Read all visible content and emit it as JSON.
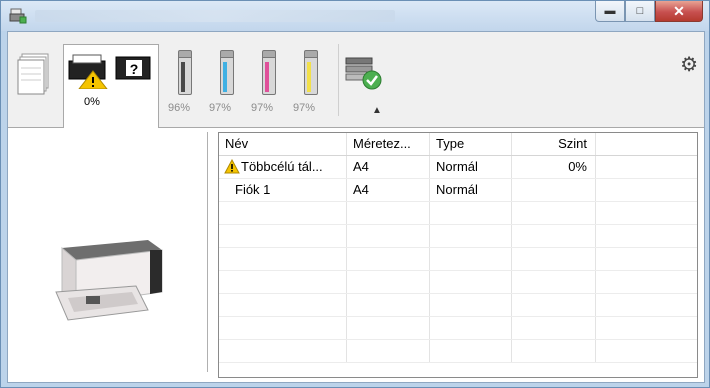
{
  "window": {
    "title_icon": "printer-app-icon",
    "buttons": {
      "minimize": "minimize-icon",
      "maximize": "maximize-icon",
      "close": "close-icon"
    }
  },
  "toolbar": {
    "status_tab": {
      "percent": "0%",
      "icons": [
        "paper-stack-icon",
        "printer-warning-icon",
        "printer-unknown-icon"
      ]
    },
    "toners": [
      {
        "percent": "96%",
        "color": "#4a4a4a"
      },
      {
        "percent": "97%",
        "color": "#3fb0e3"
      },
      {
        "percent": "97%",
        "color": "#e0509a"
      },
      {
        "percent": "97%",
        "color": "#f2e04a"
      }
    ],
    "tray_icon": "paper-tray-check-icon",
    "collapse_icon": "chevron-up-icon",
    "settings_icon": "gear-icon"
  },
  "table": {
    "columns": [
      "Név",
      "Méretez...",
      "Type",
      "Szint"
    ],
    "rows": [
      {
        "name": "Többcélú tál...",
        "size": "A4",
        "type": "Normál",
        "level": "0%",
        "warning": true
      },
      {
        "name": "Fiók 1",
        "size": "A4",
        "type": "Normál",
        "level": "",
        "warning": false
      }
    ]
  },
  "colors": {
    "warning": "#f5c400",
    "title_bar": "#c2d6ec",
    "close_button": "#c75050"
  }
}
